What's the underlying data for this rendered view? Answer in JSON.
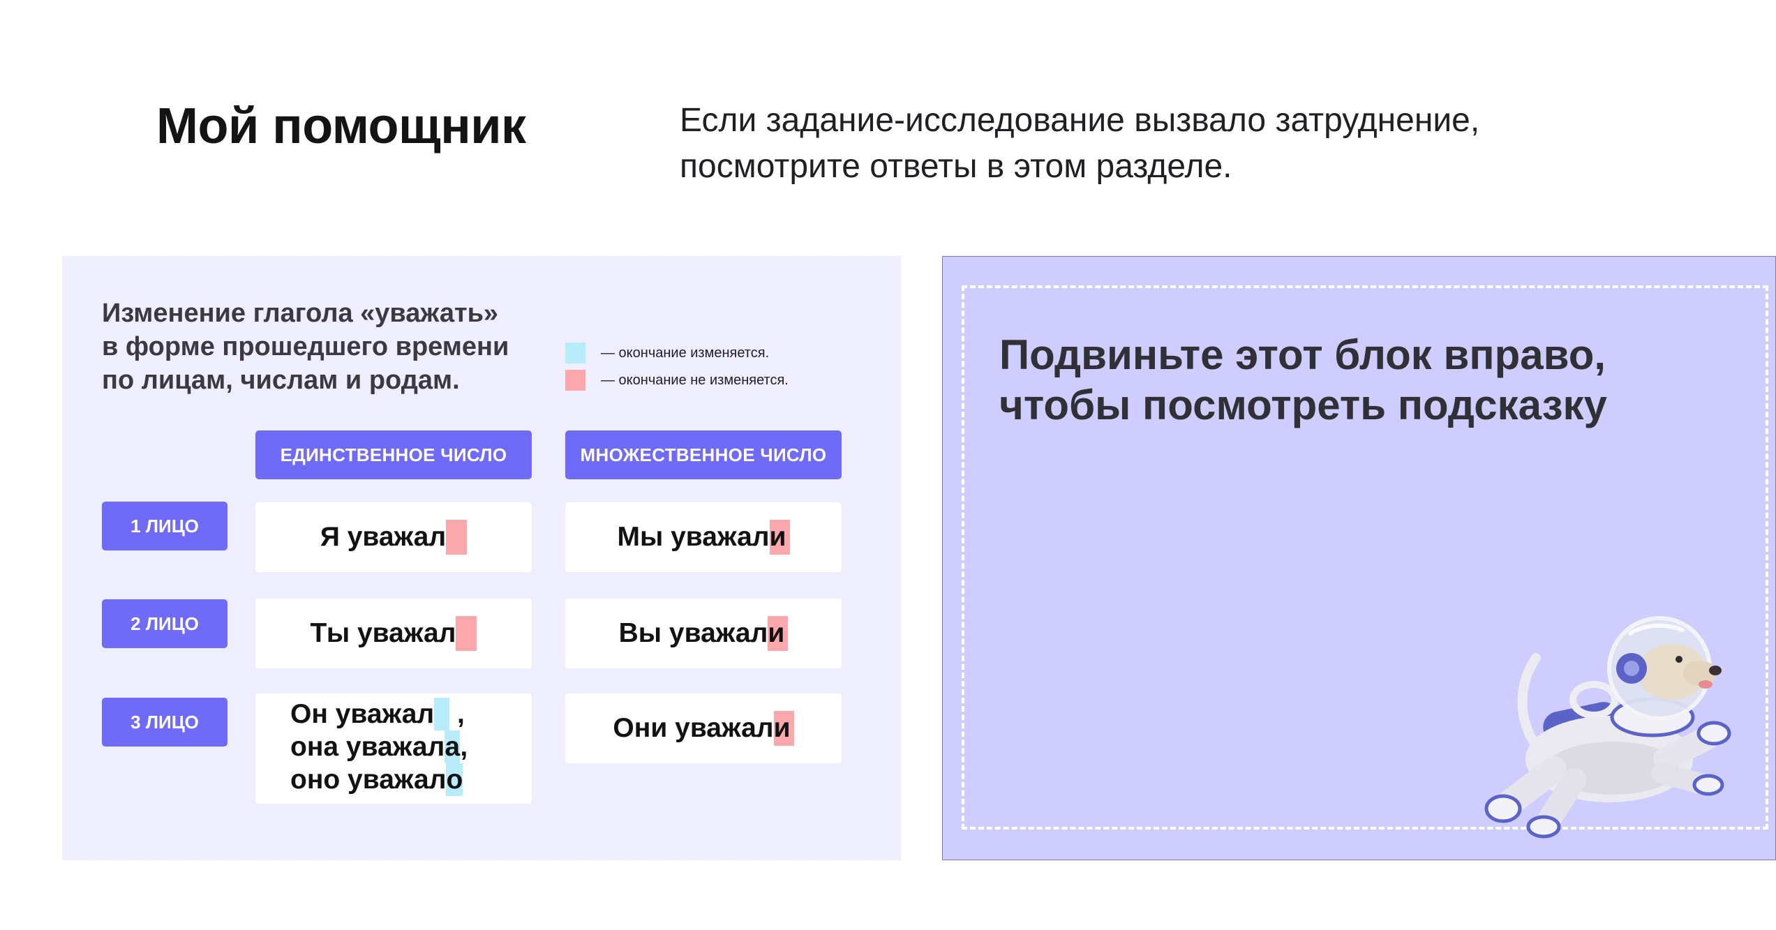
{
  "header": {
    "title": "Мой помощник",
    "intro_line1": "Если задание-исследование вызвало затруднение,",
    "intro_line2": "посмотрите ответы в этом разделе."
  },
  "table": {
    "heading_line1": "Изменение глагола «уважать»",
    "heading_line2": "в форме прошедшего времени",
    "heading_line3": "по лицам, числам и родам.",
    "legend": {
      "changes": "— окончание изменяется.",
      "no_change": "— окончание не изменяется."
    },
    "columns": {
      "singular": "ЕДИНСТВЕННОЕ ЧИСЛО",
      "plural": "МНОЖЕСТВЕННОЕ ЧИСЛО"
    },
    "rows": [
      {
        "label": "1 ЛИЦО",
        "singular_stem": "Я уважал",
        "plural_stem": "Мы уважал",
        "plural_ending": "и"
      },
      {
        "label": "2 ЛИЦО",
        "singular_stem": "Ты уважал",
        "plural_stem": "Вы уважал",
        "plural_ending": "и"
      },
      {
        "label": "3 ЛИЦО",
        "singular_m_stem": "Он уважал",
        "singular_m_after": " ,",
        "singular_f_stem": "она уважал",
        "singular_f_ending": "а",
        "singular_f_after": ",",
        "singular_n_stem": "оно уважал",
        "singular_n_ending": "о",
        "plural_stem": "Они уважал",
        "plural_ending": "и"
      }
    ]
  },
  "hint": {
    "line1": "Подвиньте этот блок вправо,",
    "line2": "чтобы посмотреть подсказку"
  },
  "colors": {
    "accent": "#6f6af8",
    "changes_highlight": "#b9ecfb",
    "no_change_highlight": "#fca7ac",
    "panel_bg": "#efeefe",
    "hint_bg": "#cfcdfd"
  },
  "icons": {
    "mascot": "astronaut-dog-icon"
  }
}
